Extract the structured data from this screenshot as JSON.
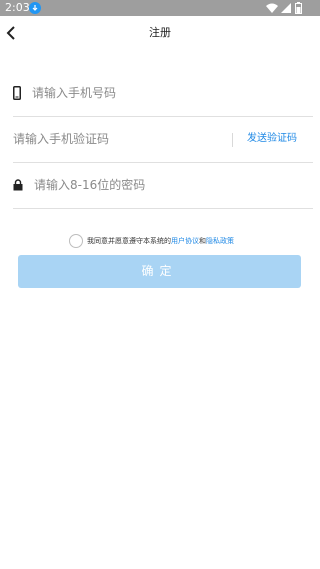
{
  "status_bar": {
    "time": "2:03",
    "icons": [
      "download-icon",
      "wifi-icon",
      "signal-icon",
      "battery-icon"
    ]
  },
  "header": {
    "back_icon": "back-arrow-icon",
    "title": "注册"
  },
  "form": {
    "phone": {
      "icon": "phone-icon",
      "placeholder": "请输入手机号码",
      "value": ""
    },
    "code": {
      "placeholder": "请输入手机验证码",
      "value": "",
      "send_label": "发送验证码"
    },
    "password": {
      "icon": "lock-icon",
      "placeholder": "请输入8-16位的密码",
      "value": ""
    }
  },
  "agreement": {
    "checked": false,
    "prefix": "我同意并愿意遵守本系统的",
    "terms_link": "用户协议",
    "conjunction": "和",
    "privacy_link": "隐私政策"
  },
  "confirm_label": "确定",
  "colors": {
    "accent": "#1e88e5",
    "button_disabled": "#a9d4f4",
    "status_bar": "#9e9e9e"
  }
}
